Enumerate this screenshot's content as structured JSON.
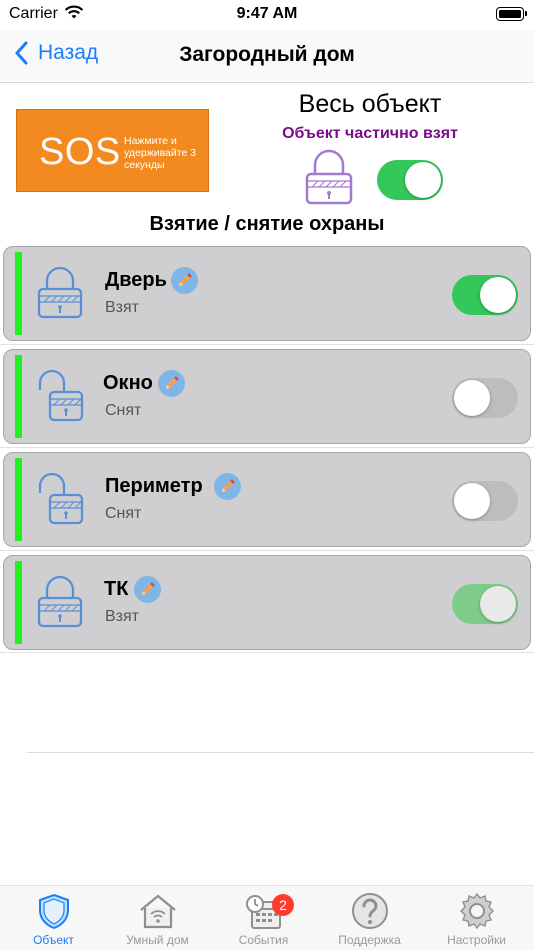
{
  "status_bar": {
    "carrier": "Carrier",
    "time": "9:47 AM"
  },
  "nav": {
    "back_label": "Назад",
    "title": "Загородный дом"
  },
  "sos": {
    "label": "SOS",
    "hint": "Нажмите и удерживайте 3 секунды"
  },
  "object": {
    "title": "Весь объект",
    "status": "Объект частично взят",
    "armed": true
  },
  "section_title": "Взятие / снятие охраны",
  "zones": [
    {
      "name": "Дверь",
      "state": "Взят",
      "armed": true
    },
    {
      "name": "Окно",
      "state": "Снят",
      "armed": false
    },
    {
      "name": "Периметр",
      "state": "Снят",
      "armed": false
    },
    {
      "name": "ТК",
      "state": "Взят",
      "armed": true
    }
  ],
  "tabs": [
    {
      "label": "Объект",
      "icon": "shield-icon",
      "active": true
    },
    {
      "label": "Умный дом",
      "icon": "smart-home-icon",
      "active": false
    },
    {
      "label": "События",
      "icon": "events-calendar-icon",
      "active": false,
      "badge": "2"
    },
    {
      "label": "Поддержка",
      "icon": "help-icon",
      "active": false
    },
    {
      "label": "Настройки",
      "icon": "gear-icon",
      "active": false
    }
  ],
  "colors": {
    "accent": "#1a7ef5",
    "toggle_on": "#34c759",
    "zone_indicator": "#22ee22",
    "partial_status": "#7d0a8a",
    "sos": "#f28a1f"
  }
}
